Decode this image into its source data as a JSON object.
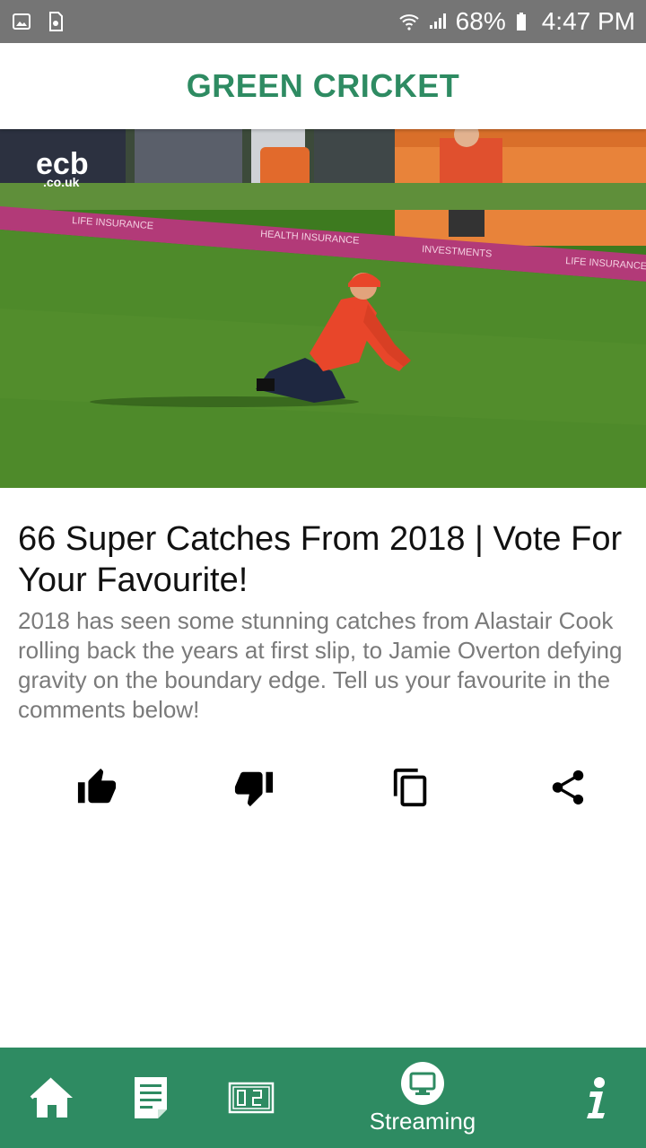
{
  "status_bar": {
    "left_icons": [
      "image-icon",
      "sim-icon"
    ],
    "right_icons": [
      "wifi-icon",
      "signal-icon",
      "battery-icon"
    ],
    "battery": "68%",
    "time": "4:47 PM"
  },
  "header": {
    "title": "GREEN CRICKET",
    "color": "#2e8b62"
  },
  "video": {
    "thumbnail": "cricket-catch-thumbnail",
    "watermark_main": "ecb",
    "watermark_sub": ".co.uk",
    "hoarding_texts": [
      "LIFE INSURANCE",
      "HEALTH INSURANCE",
      "INVESTMENTS",
      "LIFE INSURANCE"
    ]
  },
  "article": {
    "title": "66 Super Catches From 2018 | Vote For Your Favourite!",
    "description": "2018 has seen some stunning catches from Alastair Cook rolling back the years at first slip, to Jamie Overton defying gravity on the boundary edge. Tell us your favourite in the comments below!"
  },
  "actions": [
    {
      "icon": "thumbs-up-icon"
    },
    {
      "icon": "thumbs-down-icon"
    },
    {
      "icon": "copy-icon"
    },
    {
      "icon": "share-icon"
    }
  ],
  "bottom_nav": {
    "background": "#2e8b62",
    "items": [
      {
        "icon": "home-icon",
        "label": ""
      },
      {
        "icon": "news-icon",
        "label": ""
      },
      {
        "icon": "scoreboard-icon",
        "label": ""
      },
      {
        "icon": "streaming-icon",
        "label": "Streaming"
      },
      {
        "icon": "info-icon",
        "label": ""
      }
    ]
  }
}
